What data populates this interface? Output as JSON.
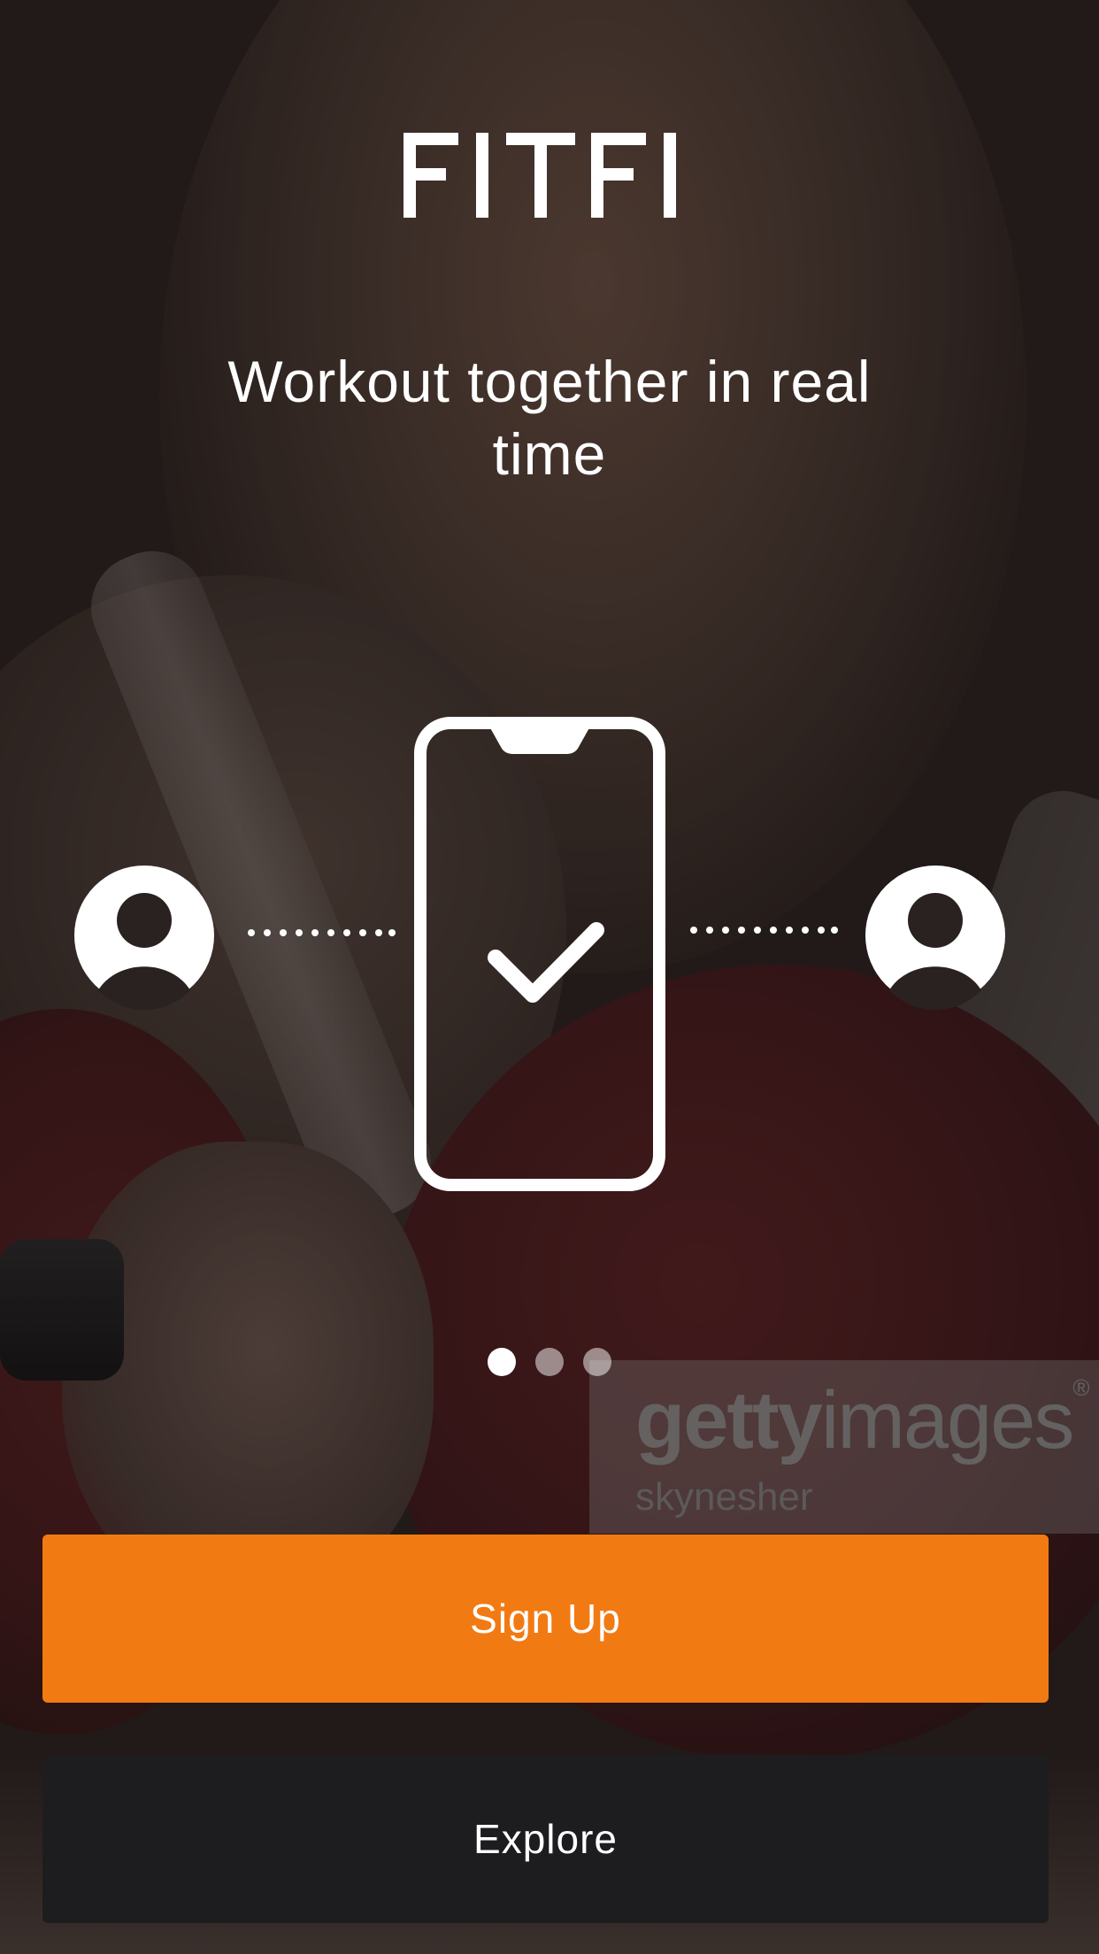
{
  "app": {
    "logo_text": "FITFI"
  },
  "onboarding": {
    "tagline": "Workout together in real time",
    "illustration_icons": [
      "user-avatar-icon",
      "dotted-connector",
      "smartphone-icon",
      "checkmark-icon",
      "dotted-connector",
      "user-avatar-icon"
    ],
    "pager": {
      "total": 3,
      "active": 1
    }
  },
  "watermark": {
    "brand_bold": "getty",
    "brand_light": "images",
    "registered": "®",
    "credit": "skynesher"
  },
  "actions": {
    "signup_label": "Sign Up",
    "explore_label": "Explore"
  },
  "colors": {
    "accent": "#f27a13",
    "secondary_button": "#1d1d1f",
    "text": "#ffffff"
  }
}
